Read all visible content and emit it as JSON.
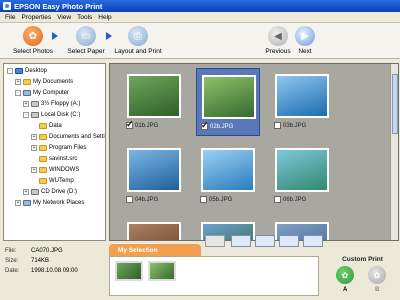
{
  "window": {
    "title": "EPSON Easy Photo Print"
  },
  "menu": [
    "File",
    "Properties",
    "View",
    "Tools",
    "Help"
  ],
  "toolbar": {
    "select_photos": "Select Photos",
    "select_paper": "Select Paper",
    "layout_print": "Layout and Print",
    "previous": "Previous",
    "next": "Next"
  },
  "tree": [
    {
      "label": "Desktop",
      "indent": 0,
      "icon": "desk",
      "toggle": "-"
    },
    {
      "label": "My Documents",
      "indent": 1,
      "icon": "folder",
      "toggle": "+"
    },
    {
      "label": "My Computer",
      "indent": 1,
      "icon": "pc",
      "toggle": "-"
    },
    {
      "label": "3½ Floppy (A:)",
      "indent": 2,
      "icon": "drive",
      "toggle": "+"
    },
    {
      "label": "Local Disk (C:)",
      "indent": 2,
      "icon": "drive",
      "toggle": "-"
    },
    {
      "label": "Data",
      "indent": 3,
      "icon": "folder",
      "toggle": ""
    },
    {
      "label": "Documents and Settings",
      "indent": 3,
      "icon": "folder",
      "toggle": "+"
    },
    {
      "label": "Program Files",
      "indent": 3,
      "icon": "folder",
      "toggle": "+"
    },
    {
      "label": "savinst.src",
      "indent": 3,
      "icon": "folder",
      "toggle": ""
    },
    {
      "label": "WINDOWS",
      "indent": 3,
      "icon": "folder",
      "toggle": "+"
    },
    {
      "label": "WUTemp",
      "indent": 3,
      "icon": "folder",
      "toggle": ""
    },
    {
      "label": "CD Drive (D:)",
      "indent": 2,
      "icon": "drive",
      "toggle": "+"
    },
    {
      "label": "My Network Places",
      "indent": 1,
      "icon": "pc",
      "toggle": "+"
    }
  ],
  "photos": [
    {
      "name": "01b.JPG",
      "checked": true,
      "selected": false,
      "colors": [
        "#6fa75a",
        "#2f5f2a"
      ]
    },
    {
      "name": "02b.JPG",
      "checked": true,
      "selected": true,
      "colors": [
        "#8ec06a",
        "#356b2f"
      ]
    },
    {
      "name": "03b.JPG",
      "checked": false,
      "selected": false,
      "colors": [
        "#8fc7ef",
        "#1d6bb0"
      ]
    },
    {
      "name": "04b.JPG",
      "checked": false,
      "selected": false,
      "colors": [
        "#7ab6e6",
        "#1f5f9c"
      ]
    },
    {
      "name": "05b.JPG",
      "checked": false,
      "selected": false,
      "colors": [
        "#9ad0f2",
        "#2a7cc0"
      ]
    },
    {
      "name": "06b.JPG",
      "checked": false,
      "selected": false,
      "colors": [
        "#7ec7de",
        "#2f8a6e"
      ]
    },
    {
      "name": "",
      "checked": false,
      "selected": false,
      "colors": [
        "#b08060",
        "#5a3d28"
      ]
    },
    {
      "name": "",
      "checked": false,
      "selected": false,
      "colors": [
        "#6ba2d0",
        "#2d5f3a"
      ]
    },
    {
      "name": "",
      "checked": false,
      "selected": false,
      "colors": [
        "#7fa0c8",
        "#3c5f80"
      ]
    }
  ],
  "file_info": {
    "file_label": "File:",
    "file": "CA070.JPG",
    "size_label": "Size:",
    "size": "714KB",
    "date_label": "Date:",
    "date": "1998.10.08 09:00"
  },
  "my_selection": {
    "title": "My Selection"
  },
  "custom_print": {
    "label": "Custom Print",
    "a": "A",
    "b": "B"
  },
  "colors": {
    "accent_orange": "#f0a050",
    "selection_blue": "#5b77b8",
    "custom_green": "#2e9a3a"
  }
}
